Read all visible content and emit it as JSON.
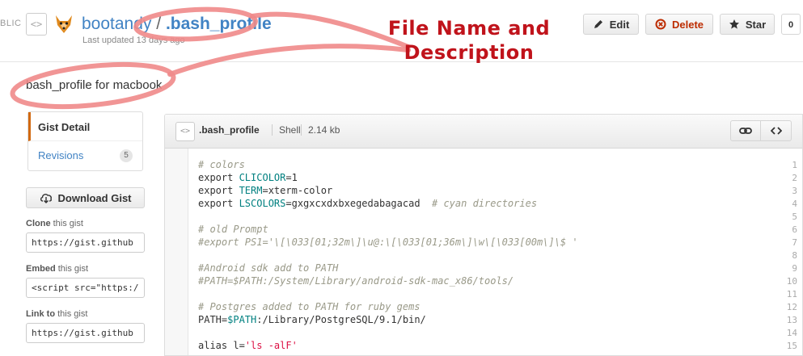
{
  "header": {
    "visibility_label": "BLIC",
    "gist_type_icon": "code-file-icon",
    "owner": "bootandy",
    "separator": "/",
    "file_title": ".bash_profile",
    "updated": "Last updated 13 days ago",
    "buttons": {
      "edit": "Edit",
      "delete": "Delete",
      "star": "Star",
      "star_count": "0"
    }
  },
  "annotation": {
    "line1": "File Name and",
    "line2": "Description",
    "color": "#c0131b"
  },
  "description": "bash_profile for macbook",
  "sidebar": {
    "nav": [
      {
        "label": "Gist Detail"
      },
      {
        "label": "Revisions",
        "count": "5"
      }
    ],
    "download_label": "Download Gist",
    "clone": {
      "bold": "Clone",
      "rest": " this gist",
      "value": "https://gist.github"
    },
    "embed": {
      "bold": "Embed",
      "rest": " this gist",
      "value": "<script src=\"https:/"
    },
    "link": {
      "bold": "Link to",
      "rest": " this gist",
      "value": "https://gist.github"
    }
  },
  "file": {
    "name": ".bash_profile",
    "language": "Shell",
    "size": "2.14 kb",
    "line_numbers": [
      "1",
      "2",
      "3",
      "4",
      "5",
      "6",
      "7",
      "8",
      "9",
      "10",
      "11",
      "12",
      "13",
      "14",
      "15"
    ]
  },
  "accent_color": "#4183c4"
}
